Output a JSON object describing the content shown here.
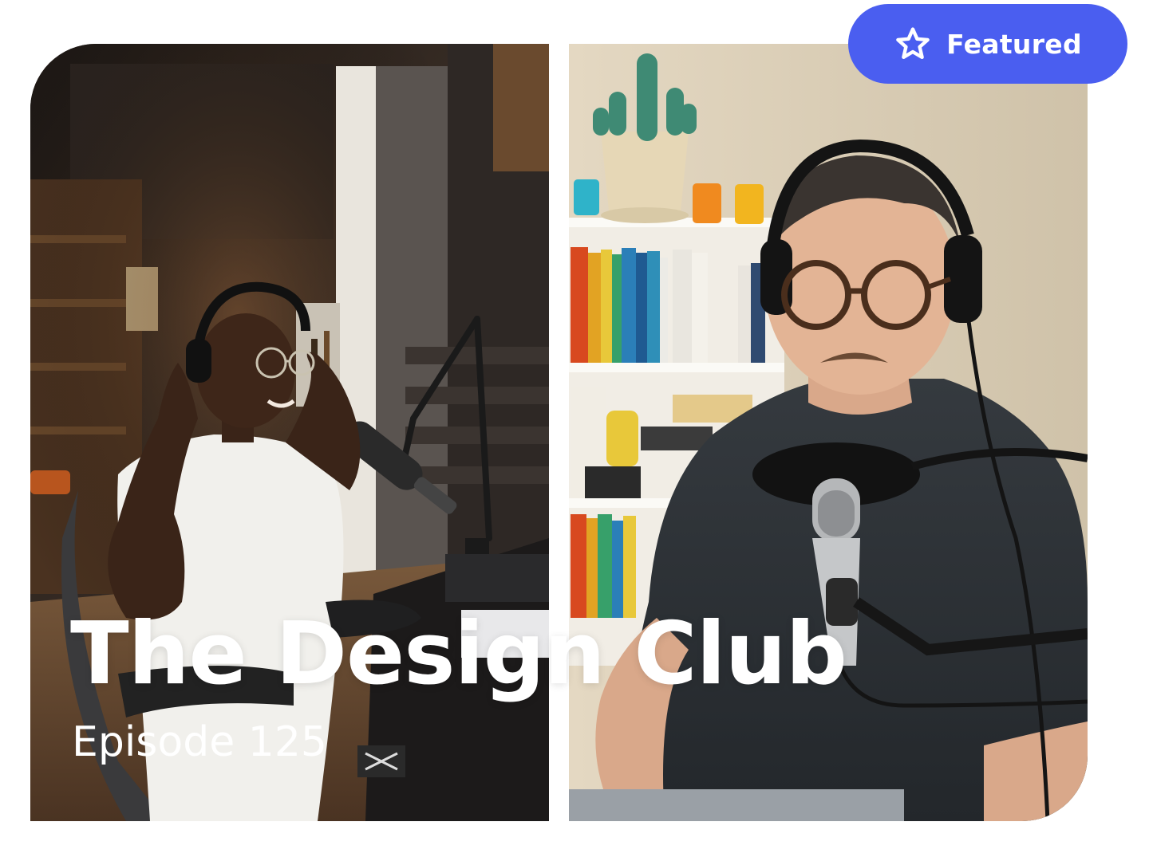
{
  "accent_color": "#4a5ef0",
  "badge": {
    "label": "Featured",
    "icon": "star-outline-icon"
  },
  "episode": {
    "title": "The Design Club",
    "subtitle": "Episode 125"
  },
  "photos": [
    {
      "name": "host-photo-left",
      "alt": "Podcast host with headphones and microphone"
    },
    {
      "name": "guest-photo-right",
      "alt": "Podcast guest with glasses speaking into microphone"
    }
  ]
}
